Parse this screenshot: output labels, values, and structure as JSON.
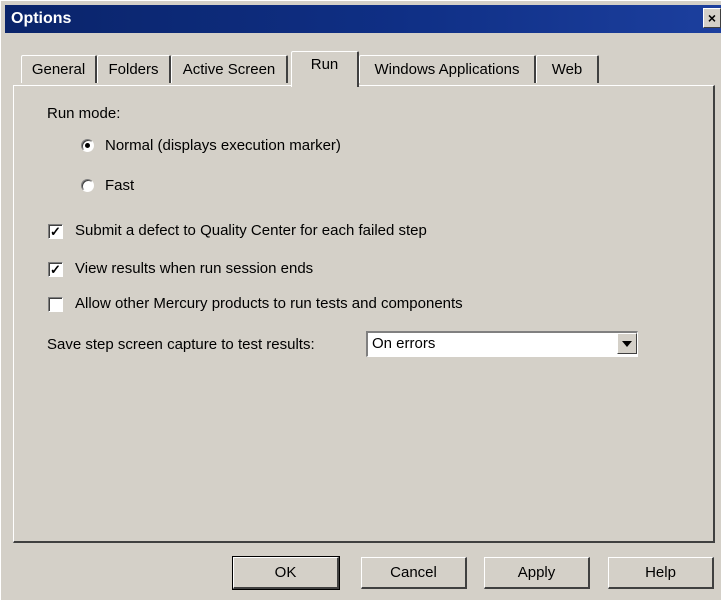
{
  "window": {
    "title": "Options",
    "close_label": "×"
  },
  "tabs": [
    {
      "label": "General",
      "active": false
    },
    {
      "label": "Folders",
      "active": false
    },
    {
      "label": "Active Screen",
      "active": false
    },
    {
      "label": "Run",
      "active": true
    },
    {
      "label": "Windows Applications",
      "active": false
    },
    {
      "label": "Web",
      "active": false
    }
  ],
  "run_tab": {
    "run_mode_label": "Run mode:",
    "run_mode_options": [
      {
        "label": "Normal (displays execution marker)",
        "selected": true
      },
      {
        "label": "Fast",
        "selected": false
      }
    ],
    "checkboxes": [
      {
        "label": "Submit a defect to Quality Center for each failed step",
        "checked": true
      },
      {
        "label": "View results when run session ends",
        "checked": true
      },
      {
        "label": "Allow other Mercury products to run tests and components",
        "checked": false
      }
    ],
    "capture_label": "Save step screen capture to test results:",
    "capture_value": "On errors"
  },
  "buttons": {
    "ok": "OK",
    "cancel": "Cancel",
    "apply": "Apply",
    "help": "Help"
  },
  "colors": {
    "title_bar": "#0a246a",
    "dialog_bg": "#d4d0c8"
  }
}
